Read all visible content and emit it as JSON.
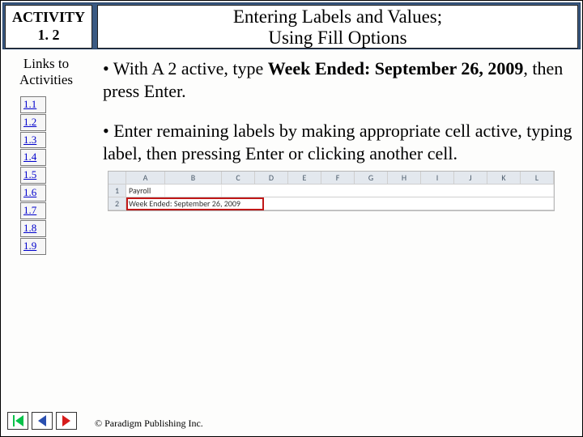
{
  "header": {
    "activity_label": "ACTIVITY",
    "activity_number": "1. 2",
    "title_line1": "Entering Labels and Values;",
    "title_line2": "Using Fill Options"
  },
  "sidebar": {
    "heading_line1": "Links to",
    "heading_line2": "Activities",
    "items": [
      {
        "label": "1.1"
      },
      {
        "label": "1.2"
      },
      {
        "label": "1.3"
      },
      {
        "label": "1.4"
      },
      {
        "label": "1.5"
      },
      {
        "label": "1.6"
      },
      {
        "label": "1.7"
      },
      {
        "label": "1.8"
      },
      {
        "label": "1.9"
      }
    ]
  },
  "content": {
    "bullet1_pre": "• With A 2 active, type ",
    "bullet1_bold": "Week Ended: September 26, 2009",
    "bullet1_post": ", then press Enter.",
    "bullet2": "• Enter remaining labels by making appropriate cell active, typing label, then pressing Enter or clicking another cell."
  },
  "screenshot": {
    "cols": [
      "A",
      "B",
      "C",
      "D",
      "E",
      "F",
      "G",
      "H",
      "I",
      "J",
      "K",
      "L"
    ],
    "rows": [
      "1",
      "2"
    ],
    "cell_a1": "Payroll",
    "cell_a2": "Week Ended: September 26, 2009"
  },
  "footer": {
    "copyright": "© Paradigm Publishing Inc."
  }
}
